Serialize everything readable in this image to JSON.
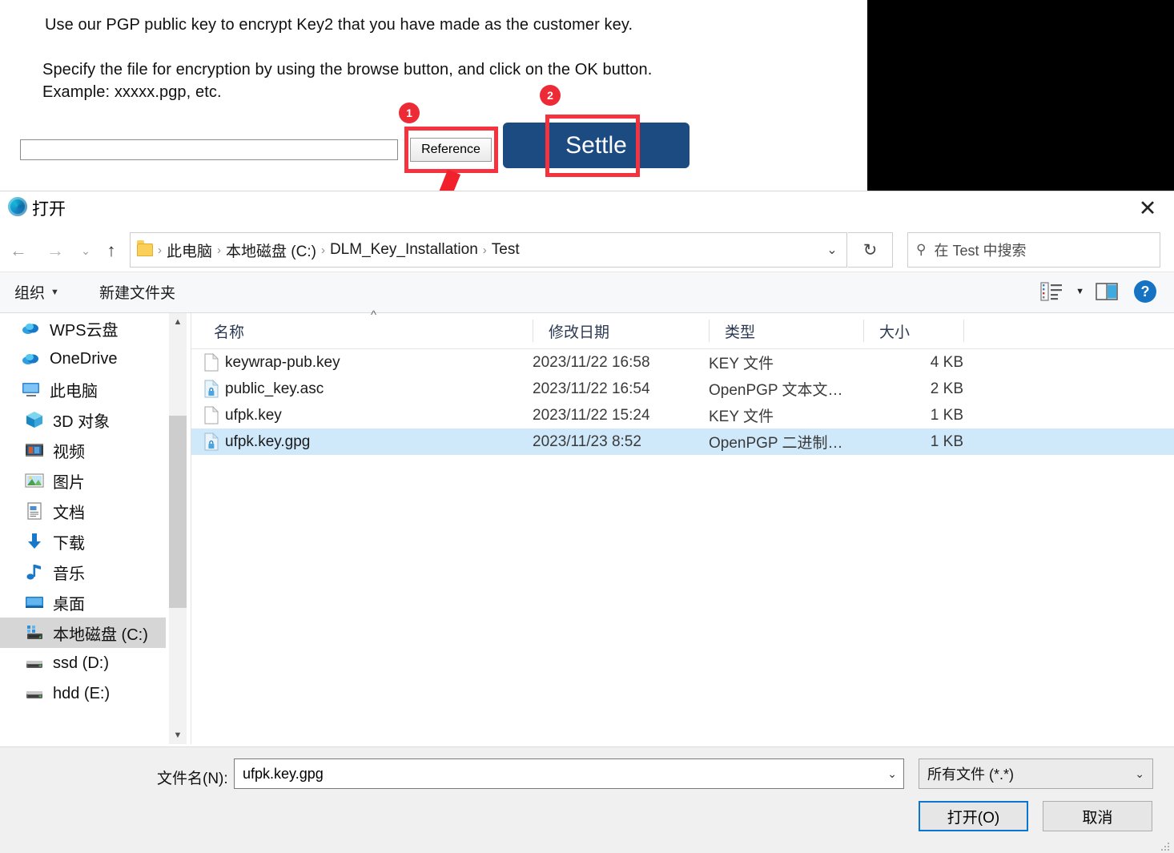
{
  "instructions": {
    "line1": "Use our PGP public key to encrypt Key2 that you have made as the customer key.",
    "line2": "Specify the file for encryption by using the browse button, and click on the OK button.",
    "line3": "Example: xxxxx.pgp, etc."
  },
  "form": {
    "path_value": "",
    "path_placeholder": "",
    "reference_label": "Reference",
    "settle_label": "Settle"
  },
  "annotations": {
    "badge1": "1",
    "badge2": "2",
    "accent_color": "#ed2b36",
    "settle_color": "#1b4b80"
  },
  "dialog": {
    "title": "打开",
    "close_label": "✕",
    "nav": {
      "back": "←",
      "forward": "→",
      "recent": "⌄",
      "up": "↑"
    },
    "breadcrumb": {
      "crumbs": [
        "此电脑",
        "本地磁盘 (C:)",
        "DLM_Key_Installation",
        "Test"
      ],
      "separator": "›",
      "chevron": "⌄",
      "refresh": "↻"
    },
    "search": {
      "icon": "search-icon",
      "placeholder": "在 Test 中搜索"
    },
    "commandbar": {
      "organize": "组织",
      "organize_caret": "▼",
      "new_folder": "新建文件夹",
      "view_caret": "▼",
      "help": "?"
    },
    "nav_pane": {
      "items": [
        {
          "label": "WPS云盘",
          "icon": "cloud-icon",
          "indent": "root",
          "selected": false
        },
        {
          "label": "OneDrive",
          "icon": "cloud-icon",
          "indent": "root",
          "selected": false
        },
        {
          "label": "此电脑",
          "icon": "pc-icon",
          "indent": "root",
          "selected": false
        },
        {
          "label": "3D 对象",
          "icon": "cube-icon",
          "indent": "indent",
          "selected": false
        },
        {
          "label": "视频",
          "icon": "video-icon",
          "indent": "indent",
          "selected": false
        },
        {
          "label": "图片",
          "icon": "picture-icon",
          "indent": "indent",
          "selected": false
        },
        {
          "label": "文档",
          "icon": "document-icon",
          "indent": "indent",
          "selected": false
        },
        {
          "label": "下载",
          "icon": "download-icon",
          "indent": "indent",
          "selected": false
        },
        {
          "label": "音乐",
          "icon": "music-icon",
          "indent": "indent",
          "selected": false
        },
        {
          "label": "桌面",
          "icon": "desktop-icon",
          "indent": "indent",
          "selected": false
        },
        {
          "label": "本地磁盘 (C:)",
          "icon": "disk-icon",
          "indent": "indent",
          "selected": true
        },
        {
          "label": "ssd (D:)",
          "icon": "drive-icon",
          "indent": "indent",
          "selected": false
        },
        {
          "label": "hdd (E:)",
          "icon": "drive-icon",
          "indent": "indent",
          "selected": false
        }
      ]
    },
    "file_list": {
      "columns": [
        "名称",
        "修改日期",
        "类型",
        "大小"
      ],
      "rows": [
        {
          "name": "keywrap-pub.key",
          "date": "2023/11/22 16:58",
          "type": "KEY 文件",
          "size": "4 KB",
          "icon": "file-icon",
          "selected": false
        },
        {
          "name": "public_key.asc",
          "date": "2023/11/22 16:54",
          "type": "OpenPGP 文本文…",
          "size": "2 KB",
          "icon": "pgp-lock-icon",
          "selected": false
        },
        {
          "name": "ufpk.key",
          "date": "2023/11/22 15:24",
          "type": "KEY 文件",
          "size": "1 KB",
          "icon": "file-icon",
          "selected": false
        },
        {
          "name": "ufpk.key.gpg",
          "date": "2023/11/23 8:52",
          "type": "OpenPGP 二进制…",
          "size": "1 KB",
          "icon": "pgp-lock-icon",
          "selected": true
        }
      ]
    },
    "footer": {
      "filename_label": "文件名(N):",
      "filename_value": "ufpk.key.gpg",
      "filename_caret": "⌄",
      "filetype_value": "所有文件 (*.*)",
      "filetype_caret": "⌄",
      "open_label": "打开(O)",
      "cancel_label": "取消"
    }
  }
}
